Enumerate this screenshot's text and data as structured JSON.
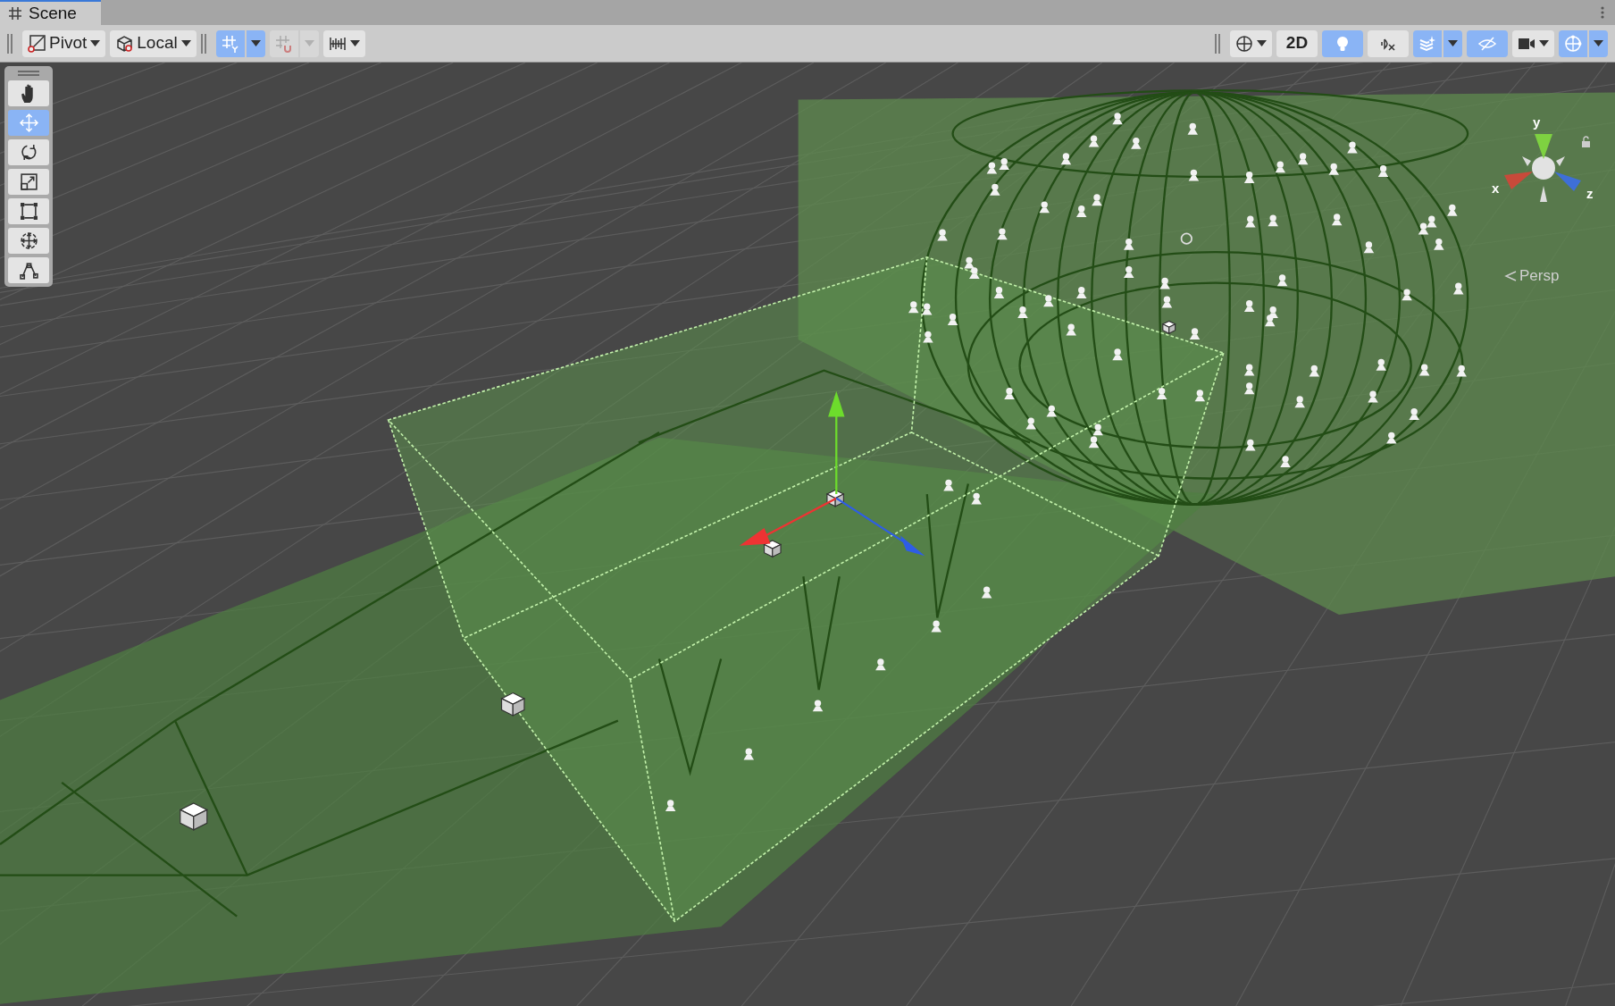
{
  "tabs": [
    {
      "label": "Scene",
      "selected": true
    }
  ],
  "toolbar": {
    "left": [
      {
        "kind": "dropdown",
        "label": "Pivot",
        "on": false,
        "disabled": false
      },
      {
        "kind": "dropdown",
        "label": "Local",
        "on": false,
        "disabled": false
      },
      {
        "kind": "split",
        "on": true,
        "disabled": false
      },
      {
        "kind": "split",
        "on": false,
        "disabled": true
      },
      {
        "kind": "dropdown",
        "on": false,
        "disabled": false
      }
    ],
    "right": [
      {
        "kind": "dropdown",
        "on": false,
        "disabled": false
      },
      {
        "kind": "button",
        "label": "2D",
        "on": false,
        "disabled": false
      },
      {
        "kind": "button",
        "on": true,
        "disabled": false
      },
      {
        "kind": "button",
        "on": false,
        "disabled": false
      },
      {
        "kind": "split",
        "on": true,
        "disabled": false
      },
      {
        "kind": "button",
        "on": true,
        "disabled": false
      },
      {
        "kind": "dropdown",
        "on": false,
        "disabled": false
      },
      {
        "kind": "split",
        "on": true,
        "disabled": false
      }
    ]
  },
  "tools": [
    {
      "selected": false
    },
    {
      "selected": true
    },
    {
      "selected": false
    },
    {
      "selected": false
    },
    {
      "selected": false
    },
    {
      "selected": false
    },
    {
      "selected": false
    }
  ],
  "orientation_gizmo": {
    "axes": [
      "y",
      "x",
      "z"
    ],
    "projection": "Persp"
  }
}
